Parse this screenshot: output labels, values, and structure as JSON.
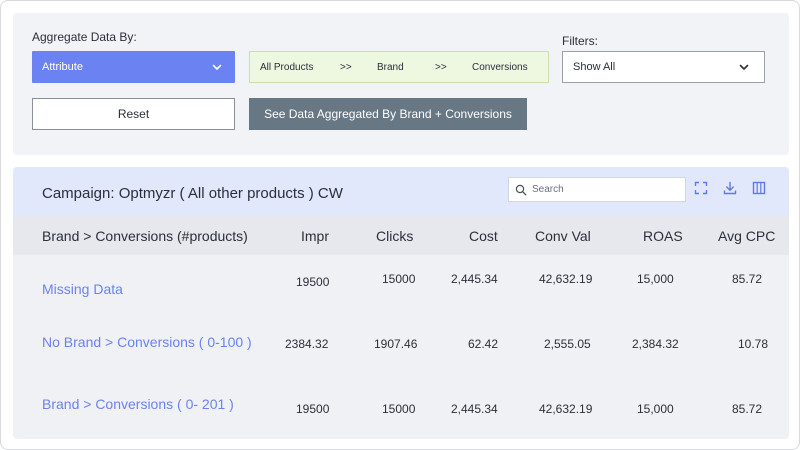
{
  "controls": {
    "aggregate_label": "Aggregate Data By:",
    "aggregate_selected": "Attribute",
    "filters_label": "Filters:",
    "filter_selected": "Show All",
    "breadcrumb": [
      "All Products",
      ">>",
      "Brand",
      ">>",
      "Conversions"
    ],
    "reset_label": "Reset",
    "aggregate_button_label": "See Data Aggregated By Brand + Conversions"
  },
  "table": {
    "campaign_title": "Campaign: Optmyzr ( All other products ) CW",
    "search_placeholder": "Search",
    "columns": [
      "Brand > Conversions (#products)",
      "Impr",
      "Clicks",
      "Cost",
      "Conv Val",
      "ROAS",
      "Avg CPC"
    ],
    "rows": [
      {
        "name": "Missing Data",
        "impr": "19500",
        "clicks": "15000",
        "cost": "2,445.34",
        "conv_val": "42,632.19",
        "roas": "15,000",
        "avg_cpc": "85.72"
      },
      {
        "name": "No Brand > Conversions ( 0-100 )",
        "impr": "2384.32",
        "clicks": "1907.46",
        "cost": "62.42",
        "conv_val": "2,555.05",
        "roas": "2,384.32",
        "avg_cpc": "10.78"
      },
      {
        "name": "Brand > Conversions ( 0- 201 )",
        "impr": "19500",
        "clicks": "15000",
        "cost": "2,445.34",
        "conv_val": "42,632.19",
        "roas": "15,000",
        "avg_cpc": "85.72"
      }
    ]
  },
  "icons": {
    "dropdown": "chevron-down-icon",
    "search": "search-icon",
    "fullscreen": "fullscreen-icon",
    "download": "download-icon",
    "columns": "columns-icon"
  },
  "colors": {
    "accent": "#6b82f3",
    "breadcrumb_bg": "#eef7df",
    "aggregate_button": "#677784",
    "table_header_bar": "#e2e8fb"
  }
}
